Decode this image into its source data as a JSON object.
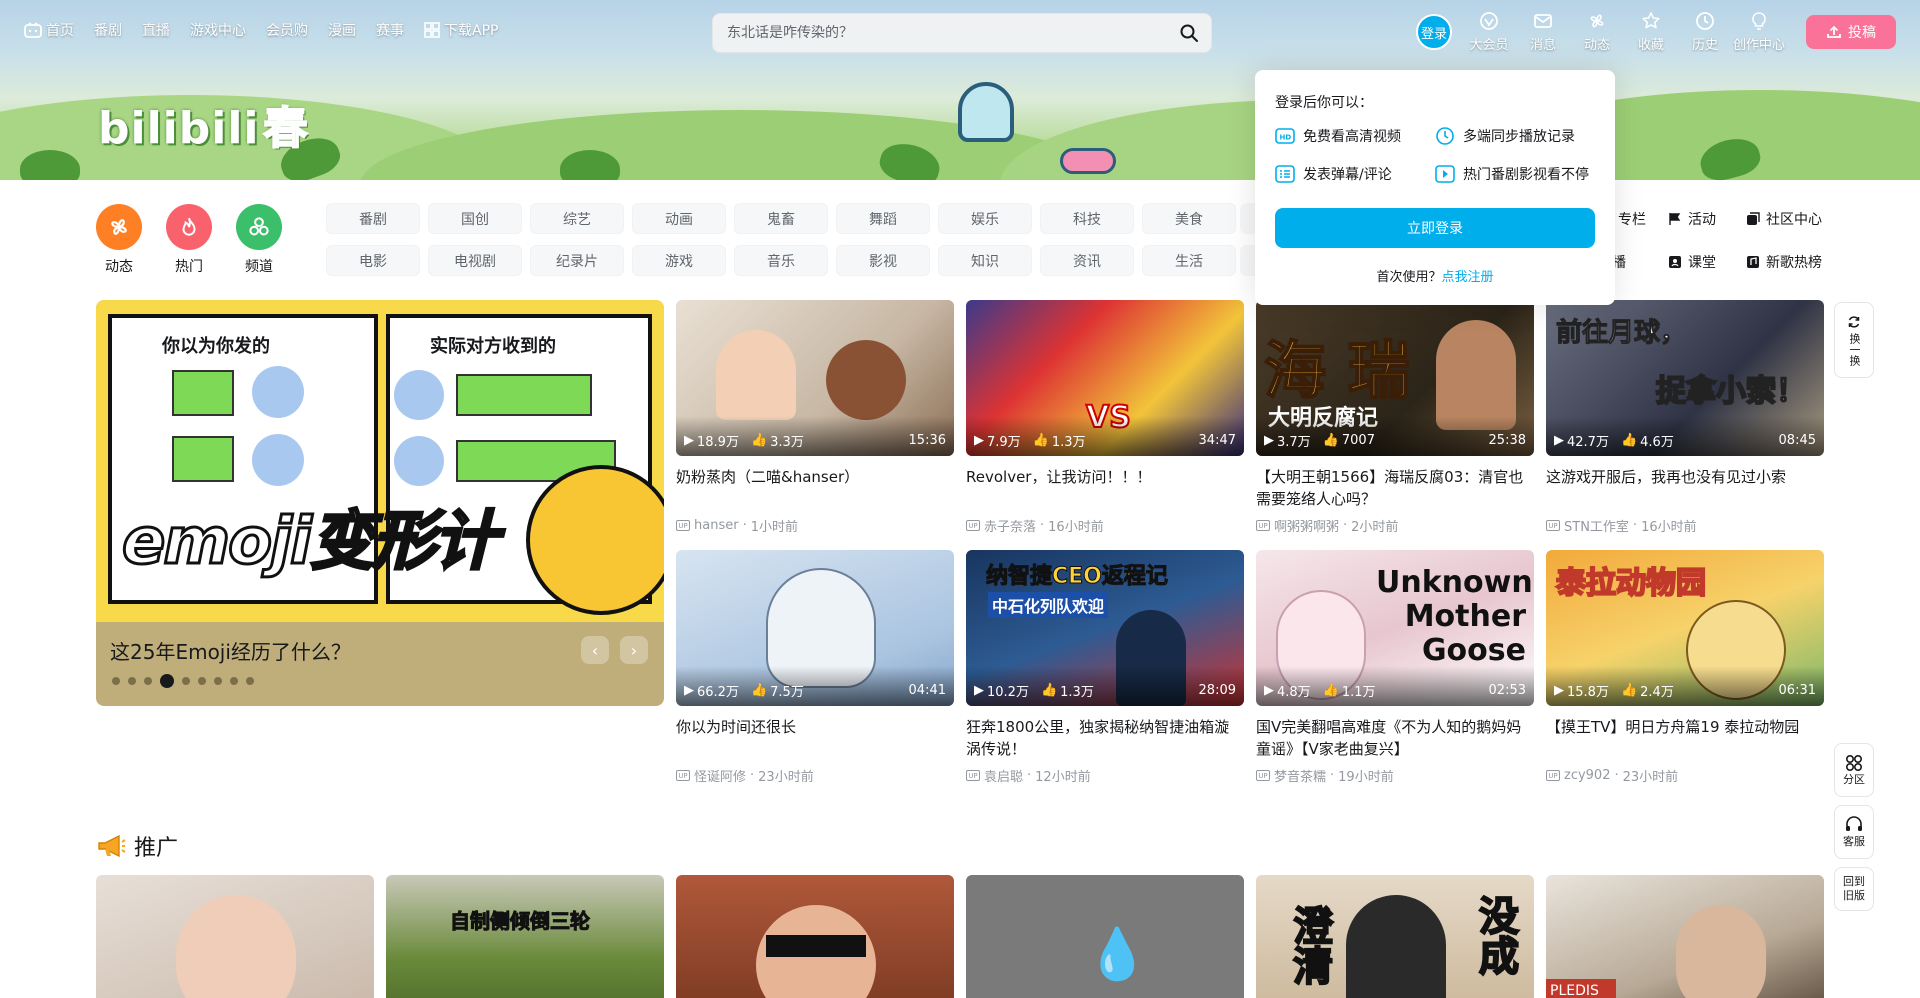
{
  "nav": {
    "left": [
      {
        "label": "首页",
        "icon": "tv-icon"
      },
      {
        "label": "番剧"
      },
      {
        "label": "直播"
      },
      {
        "label": "游戏中心"
      },
      {
        "label": "会员购"
      },
      {
        "label": "漫画"
      },
      {
        "label": "赛事"
      },
      {
        "label": "下载APP",
        "icon": "qr-grid-icon"
      }
    ],
    "search_placeholder": "东北话是咋传染的？",
    "login": "登录",
    "right": [
      {
        "label": "大会员",
        "icon": "vip-icon"
      },
      {
        "label": "消息",
        "icon": "mail-icon"
      },
      {
        "label": "动态",
        "icon": "windmill-icon"
      },
      {
        "label": "收藏",
        "icon": "star-icon"
      },
      {
        "label": "历史",
        "icon": "clock-icon"
      },
      {
        "label": "创作中心",
        "icon": "bulb-icon"
      }
    ],
    "upload": "投稿"
  },
  "brand": {
    "logo_text": "bilibili",
    "logo_suffix": "春"
  },
  "channels": {
    "big": [
      {
        "label": "动态",
        "color": "#ff7f24"
      },
      {
        "label": "热门",
        "color": "#f9626d"
      },
      {
        "label": "频道",
        "color": "#3bbf6b"
      }
    ],
    "tags": [
      "番剧",
      "国创",
      "综艺",
      "动画",
      "鬼畜",
      "舞蹈",
      "娱乐",
      "科技",
      "美食",
      "电影",
      "电视剧",
      "纪录片",
      "游戏",
      "音乐",
      "影视",
      "知识",
      "资讯",
      "生活"
    ],
    "right_links": [
      {
        "label": "专栏"
      },
      {
        "label": "活动"
      },
      {
        "label": "社区中心"
      },
      {
        "label": "直播"
      },
      {
        "label": "课堂"
      },
      {
        "label": "新歌热榜"
      }
    ]
  },
  "carousel": {
    "left_caption": "你以为你发的",
    "right_caption": "实际对方收到的",
    "big_text": "emoji变形计",
    "title": "这25年Emoji经历了什么？",
    "dots": 9,
    "active_dot": 3
  },
  "videos": [
    {
      "views": "18.9万",
      "likes": "3.3万",
      "duration": "15:36",
      "title": "奶粉蒸肉（二喵&hanser）",
      "author": "hanser",
      "time": "1小时前"
    },
    {
      "views": "7.9万",
      "likes": "1.3万",
      "duration": "34:47",
      "title": "Revolver，让我访问！！！",
      "author": "赤子奈落",
      "time": "16小时前"
    },
    {
      "views": "3.7万",
      "likes": "7007",
      "duration": "25:38",
      "title": "【大明王朝1566】海瑞反腐03：清官也需要笼络人心吗？",
      "author": "啊粥粥啊粥",
      "time": "2小时前"
    },
    {
      "views": "42.7万",
      "likes": "4.6万",
      "duration": "08:45",
      "title": "这游戏开服后，我再也没有见过小索",
      "author": "STN工作室",
      "time": "16小时前"
    },
    {
      "views": "66.2万",
      "likes": "7.5万",
      "duration": "04:41",
      "title": "你以为时间还很长",
      "author": "怪诞阿修",
      "time": "23小时前"
    },
    {
      "views": "10.2万",
      "likes": "1.3万",
      "duration": "28:09",
      "title": "狂奔1800公里，独家揭秘纳智捷油箱漩涡传说！",
      "author": "袁启聪",
      "time": "12小时前"
    },
    {
      "views": "4.8万",
      "likes": "1.1万",
      "duration": "02:53",
      "title": "国V完美翻唱高难度《不为人知的鹅妈妈童谣》【V家老曲复兴】",
      "author": "梦音茶糯",
      "time": "19小时前"
    },
    {
      "views": "15.8万",
      "likes": "2.4万",
      "duration": "06:31",
      "title": "【摸王TV】明日方舟篇19 泰拉动物园",
      "author": "zcy902",
      "time": "23小时前"
    }
  ],
  "thumb_text": {
    "v3": "海 瑞",
    "v3b": "大明反腐记",
    "v4": "前往月球，",
    "v4b": "捉拿小索！",
    "v6": "纳智捷CEO返程记",
    "v6b": "中石化列队欢迎",
    "v7": "Unknown Mother Goose",
    "v8": "泰拉动物园"
  },
  "promo": {
    "title": "推广",
    "thumb_text_1": "自制侧倾倒三轮",
    "thumb_text_2": "澄清",
    "thumb_text_3": "没成"
  },
  "side": {
    "refresh": "换一换",
    "zone": "分区",
    "service": "客服",
    "old": "回到旧版"
  },
  "popover": {
    "heading": "登录后你可以：",
    "items": [
      {
        "label": "免费看高清视频",
        "icon": "hd-icon"
      },
      {
        "label": "多端同步播放记录",
        "icon": "clock-icon"
      },
      {
        "label": "发表弹幕/评论",
        "icon": "list-icon"
      },
      {
        "label": "热门番剧影视看不停",
        "icon": "play-icon"
      }
    ],
    "login_button": "立即登录",
    "register_prefix": "首次使用？",
    "register_link": "点我注册"
  }
}
